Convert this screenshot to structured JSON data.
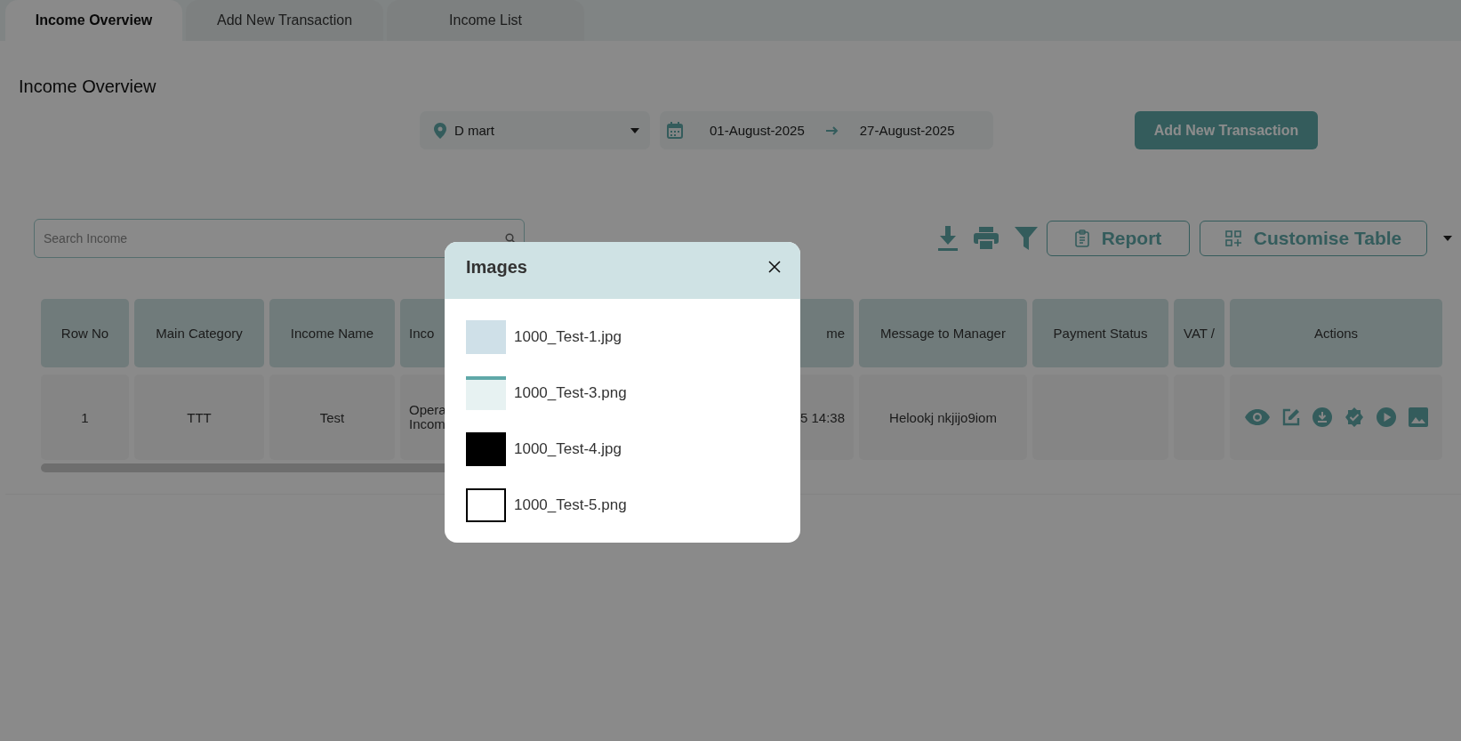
{
  "tabs": [
    {
      "label": "Income Overview",
      "selected": true
    },
    {
      "label": "Add New Transaction",
      "selected": false
    },
    {
      "label": "Income List",
      "selected": false
    }
  ],
  "page_title": "Income Overview",
  "filters": {
    "location": "D mart",
    "date_from": "01-August-2025",
    "date_to": "27-August-2025"
  },
  "add_button": "Add New Transaction",
  "search": {
    "placeholder": "Search Income"
  },
  "toolbar": {
    "report_button": "Report",
    "customise_button": "Customise Table"
  },
  "table": {
    "columns": [
      "Row No",
      "Main Category",
      "Income Name",
      "Inco",
      "me",
      "Message to Manager",
      "Payment Status",
      "VAT /",
      "Actions"
    ],
    "rows": [
      {
        "cells": [
          "1",
          "TTT",
          "Test",
          "Opera Incom",
          "5 14:38",
          "Helookj nkjijo9iom"
        ]
      }
    ]
  },
  "modal": {
    "title": "Images",
    "files": [
      {
        "name": "1000_Test-1.jpg"
      },
      {
        "name": "1000_Test-3.png"
      },
      {
        "name": "1000_Test-4.jpg"
      },
      {
        "name": "1000_Test-5.png"
      }
    ]
  }
}
